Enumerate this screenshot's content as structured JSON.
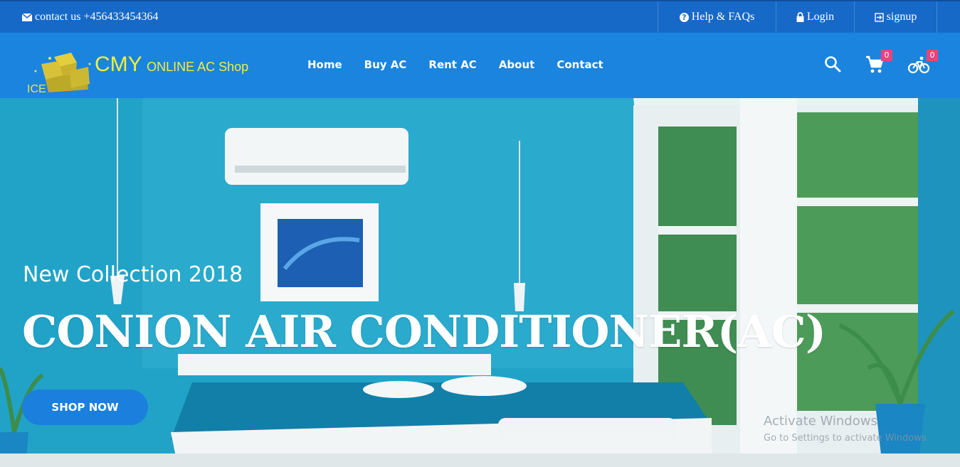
{
  "topbar": {
    "contact_text": "contact us +456433454364",
    "links": [
      {
        "label": "Help & FAQs",
        "icon": "question-circle-icon"
      },
      {
        "label": "Login",
        "icon": "lock-icon"
      },
      {
        "label": "signup",
        "icon": "signup-icon"
      }
    ]
  },
  "navbar": {
    "logo_text": "ICE",
    "brand_main": "CMY",
    "brand_sub": "ONLINE AC Shop",
    "menu": [
      "Home",
      "Buy AC",
      "Rent AC",
      "About",
      "Contact"
    ],
    "cart_count": "0",
    "bike_count": "0"
  },
  "hero": {
    "subtitle": "New Collection 2018",
    "title": "CONION AIR CONDITIONER(AC)",
    "button_label": "SHOP NOW"
  },
  "watermark": {
    "title": "Activate Windows",
    "subtitle": "Go to Settings to activate Windows."
  },
  "colors": {
    "topbar": "#1769c7",
    "navbar": "#1a84de",
    "brand": "#f2ef3a",
    "badge": "#e8457a",
    "button": "#1b7fdd"
  }
}
